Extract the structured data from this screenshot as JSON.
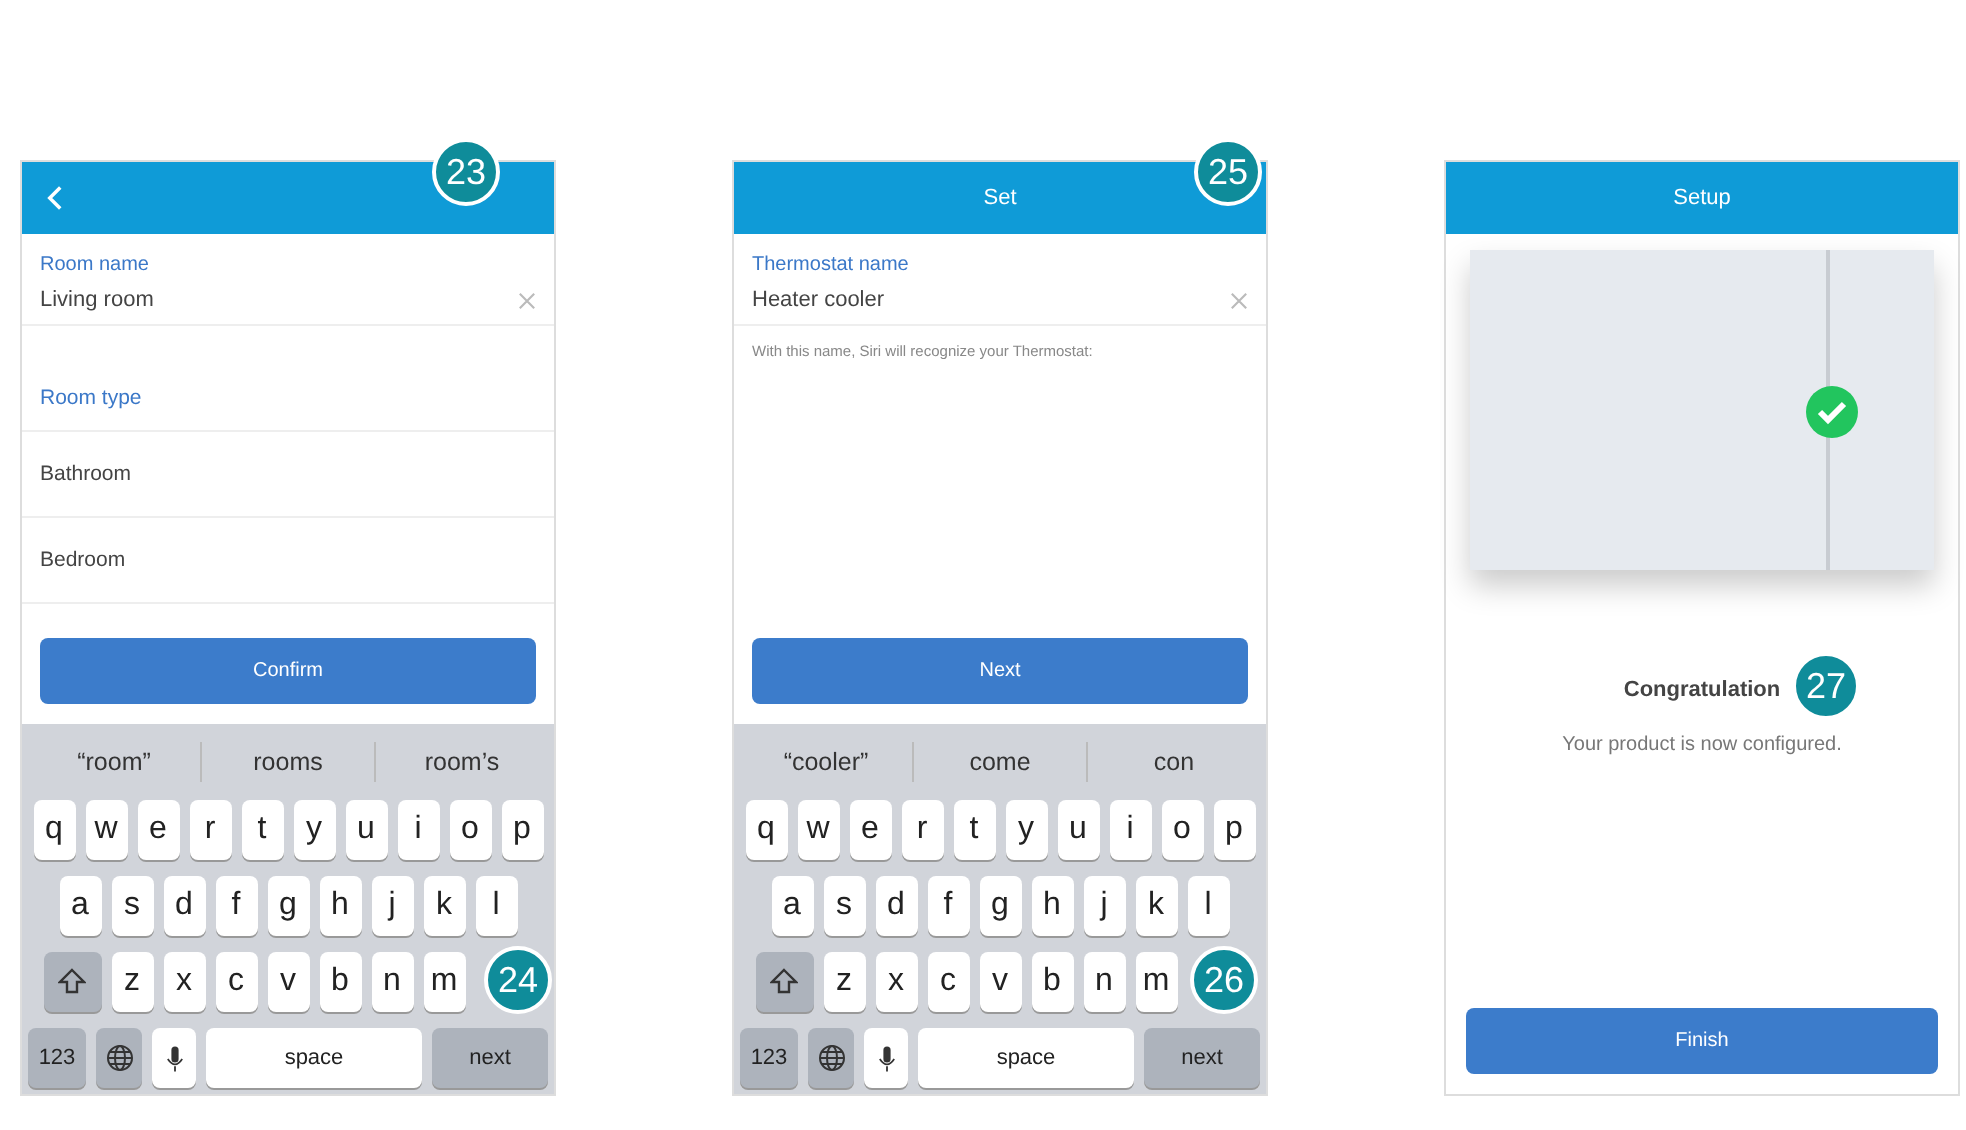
{
  "screens": [
    {
      "kind": "form",
      "field": {
        "label": "Room name",
        "value": "Living room"
      },
      "section_title": "Room type",
      "options": [
        "Bathroom",
        "Bedroom"
      ],
      "button": "Confirm",
      "keyboard": {
        "suggestions": [
          "“room”",
          "rooms",
          "room’s"
        ],
        "rows": [
          [
            "q",
            "w",
            "e",
            "r",
            "t",
            "y",
            "u",
            "i",
            "o",
            "p"
          ],
          [
            "a",
            "s",
            "d",
            "f",
            "g",
            "h",
            "j",
            "k",
            "l"
          ],
          [
            "z",
            "x",
            "c",
            "v",
            "b",
            "n",
            "m"
          ]
        ],
        "numbers_key": "123",
        "space_key": "space",
        "return_key": "next"
      },
      "badges": [
        "23",
        "24"
      ]
    },
    {
      "kind": "form",
      "title": "Set",
      "field": {
        "label": "Thermostat name",
        "value": "Heater cooler"
      },
      "hint": "With this name, Siri will recognize your Thermostat:",
      "button": "Next",
      "keyboard": {
        "suggestions": [
          "“cooler”",
          "come",
          "con"
        ],
        "rows": [
          [
            "q",
            "w",
            "e",
            "r",
            "t",
            "y",
            "u",
            "i",
            "o",
            "p"
          ],
          [
            "a",
            "s",
            "d",
            "f",
            "g",
            "h",
            "j",
            "k",
            "l"
          ],
          [
            "z",
            "x",
            "c",
            "v",
            "b",
            "n",
            "m"
          ]
        ],
        "numbers_key": "123",
        "space_key": "space",
        "return_key": "next"
      },
      "badges": [
        "25",
        "26"
      ]
    },
    {
      "kind": "done",
      "title": "Setup",
      "heading": "Congratulation",
      "message": "Your product is now configured.",
      "button": "Finish",
      "badges": [
        "27"
      ]
    }
  ]
}
